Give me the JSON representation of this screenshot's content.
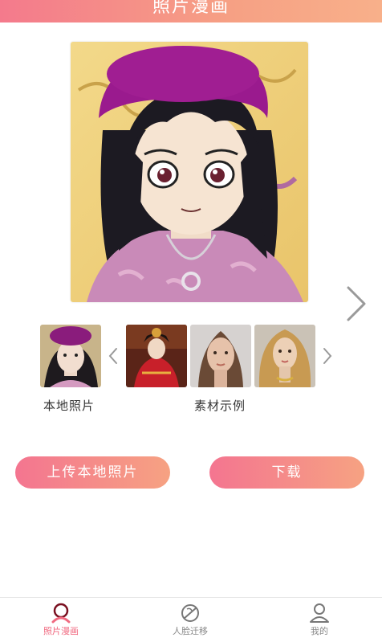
{
  "header": {
    "title": "照片漫画"
  },
  "preview": {
    "next_icon": "chevron-right-icon"
  },
  "gallery": {
    "local_caption": "本地照片",
    "samples_caption": "素材示例",
    "prev_icon": "chevron-left-icon",
    "next_icon": "chevron-right-icon"
  },
  "actions": {
    "upload_label": "上传本地照片",
    "download_label": "下载"
  },
  "tabbar": {
    "tabs": [
      {
        "label": "照片漫画",
        "icon": "person-pin-icon",
        "active": true
      },
      {
        "label": "人脸迁移",
        "icon": "swap-face-icon",
        "active": false
      },
      {
        "label": "我的",
        "icon": "user-icon",
        "active": false
      }
    ]
  },
  "colors": {
    "accent": "#f06a80",
    "gradient_start": "#f47590",
    "gradient_end": "#f6a282"
  }
}
